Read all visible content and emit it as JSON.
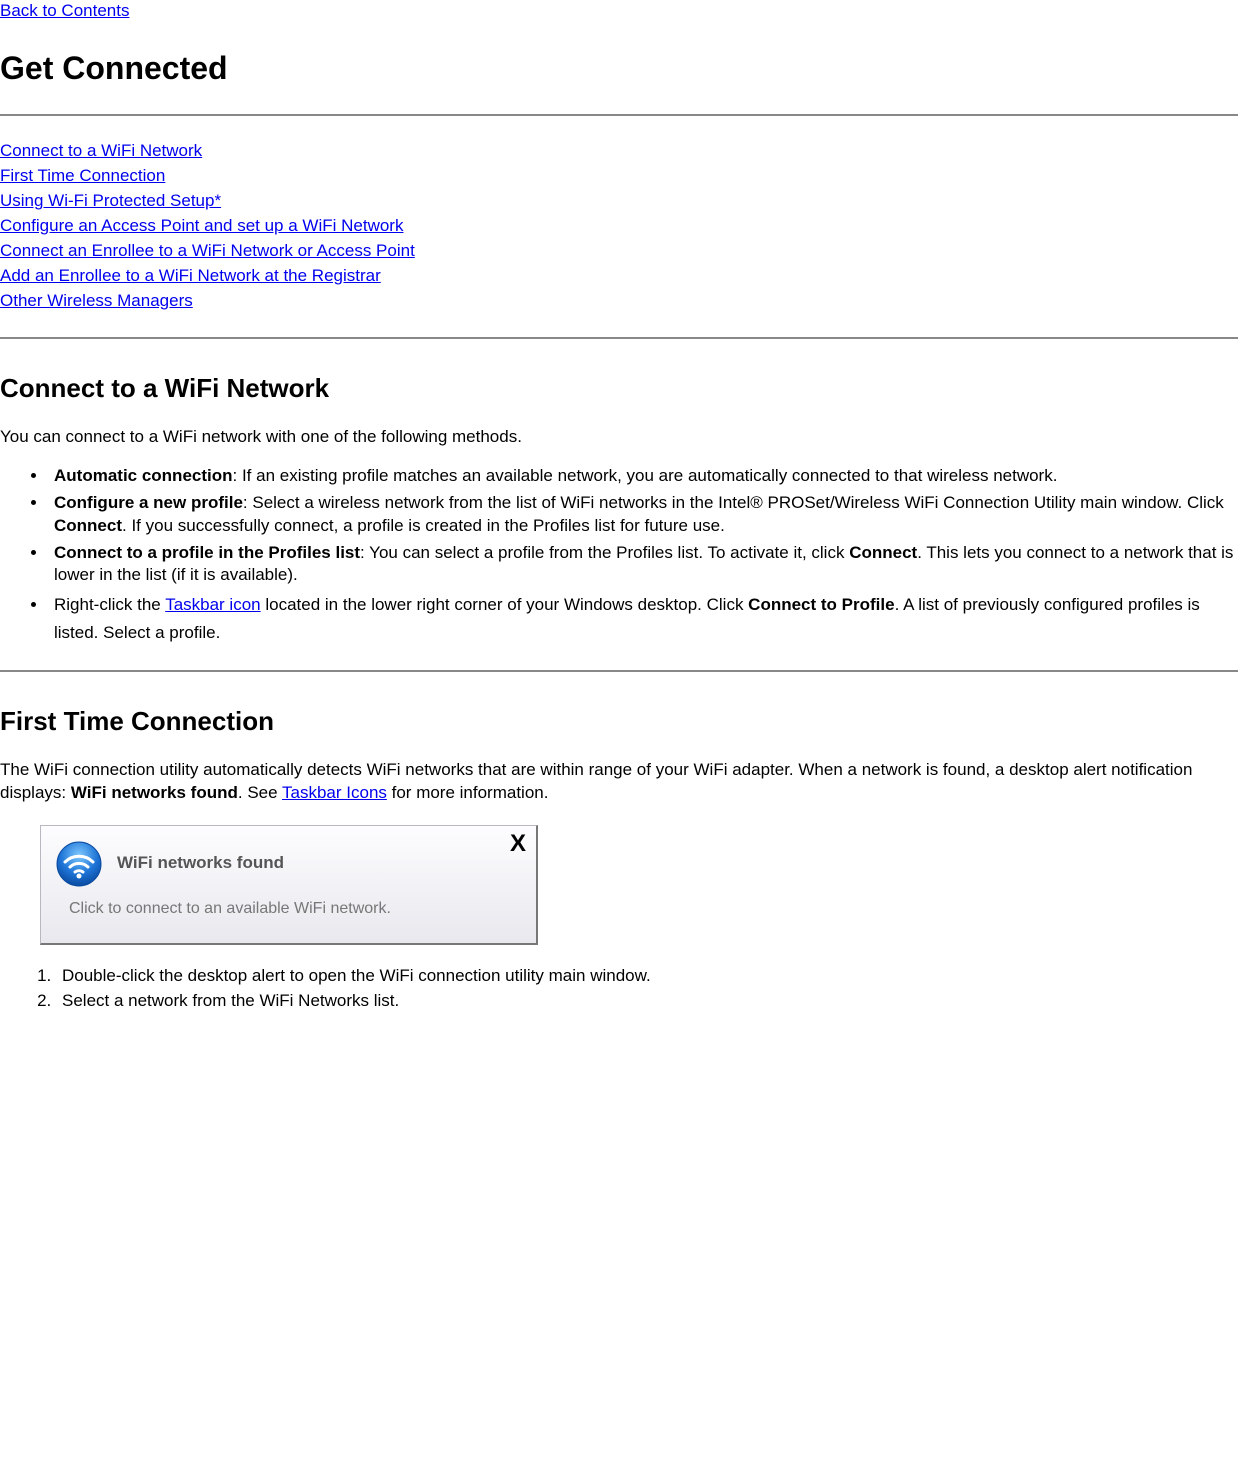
{
  "nav": {
    "back_label": "Back to Contents"
  },
  "title": "Get Connected",
  "toc": {
    "l1": "Connect to a WiFi Network",
    "l2": "First Time Connection",
    "l3": "Using Wi-Fi Protected Setup*",
    "l4": "Configure an Access Point and set up a WiFi Network ",
    "l5": "Connect an Enrollee to a WiFi Network or Access Point ",
    "l6": "Add an Enrollee to a WiFi Network at the Registrar",
    "l7": "Other Wireless Managers"
  },
  "s1": {
    "heading": "Connect to a WiFi Network",
    "intro": "You can connect to a WiFi network with one of the following methods.",
    "b1_label": "Automatic connection",
    "b1_text": ": If an existing profile matches an available network, you are automatically connected to that wireless network.",
    "b2_label": "Configure a new profile",
    "b2_text_a": ": Select a wireless network from the list of WiFi networks in the Intel® PROSet/Wireless WiFi Connection Utility main window. Click ",
    "b2_connect": "Connect",
    "b2_text_b": ". If you successfully connect, a profile is created in the Profiles list for future use.",
    "b3_label": "Connect to a profile in the Profiles list",
    "b3_text_a": ": You can select a profile from the Profiles list. To activate it, click ",
    "b3_connect": "Connect",
    "b3_text_b": ". This lets you connect to a network that is lower in the list (if it is available).",
    "b4_text_a": "Right-click the ",
    "b4_link": "Taskbar icon",
    "b4_text_b": " located in the lower right corner of your Windows desktop. Click ",
    "b4_bold": "Connect to Profile",
    "b4_text_c": ". A list of previously configured profiles is listed. Select a profile."
  },
  "s2": {
    "heading": "First Time Connection",
    "p1_a": "The WiFi connection utility automatically detects WiFi networks that are within range of your WiFi adapter. When a network is found, a desktop alert notification displays: ",
    "p1_bold": "WiFi networks found",
    "p1_b": ". See ",
    "p1_link": "Taskbar Icons",
    "p1_c": " for more information.",
    "notif_title": "WiFi networks found",
    "notif_body": "Click to connect to an available WiFi network.",
    "notif_close": "X",
    "step1": "Double-click the desktop alert to open the WiFi connection utility main window.",
    "step2": "Select a network from the WiFi Networks list."
  }
}
